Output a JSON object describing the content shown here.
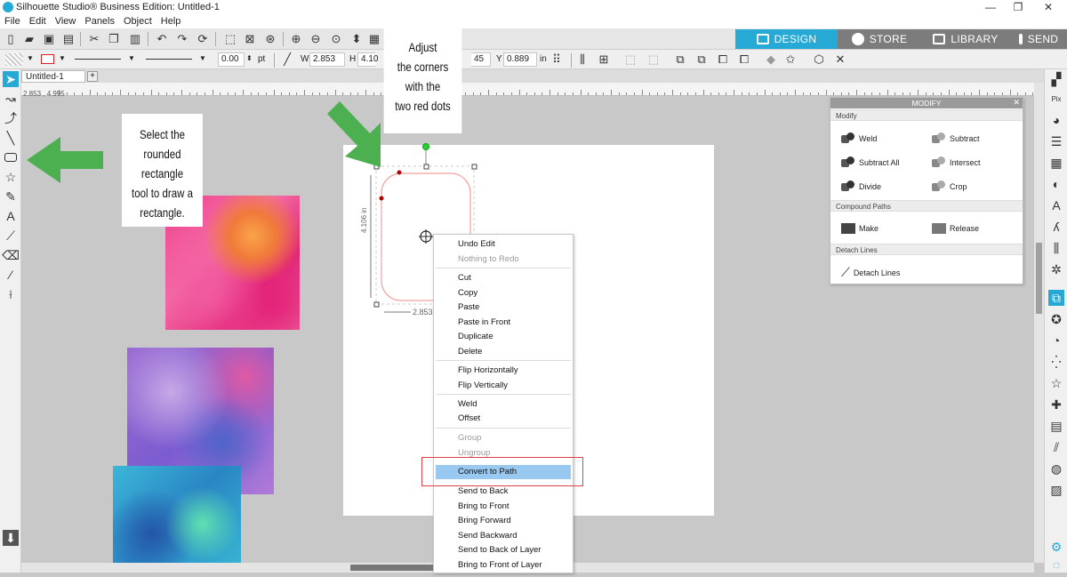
{
  "window": {
    "title": "Silhouette Studio® Business Edition: Untitled-1"
  },
  "menu": [
    "File",
    "Edit",
    "View",
    "Panels",
    "Object",
    "Help"
  ],
  "mode_tabs": [
    {
      "label": "DESIGN",
      "active": true
    },
    {
      "label": "STORE",
      "active": false
    },
    {
      "label": "LIBRARY",
      "active": false
    },
    {
      "label": "SEND",
      "active": false
    }
  ],
  "toolbar2": {
    "line_width": "0.00",
    "line_unit": "pt",
    "w_label": "W",
    "w_value": "2.853",
    "h_label": "H",
    "h_value": "4.10",
    "x_value": "45",
    "y_label": "Y",
    "y_value": "0.889",
    "y_unit": "in"
  },
  "tab": {
    "name": "Untitled-1",
    "add": "+"
  },
  "ruler": {
    "coords": "2.853 , 4.995"
  },
  "dimensions": {
    "height": "4.106 in",
    "width": "2.853"
  },
  "callouts": {
    "left": [
      "Select the",
      "rounded rectangle",
      "tool to draw a",
      "rectangle."
    ],
    "top": [
      "Adjust",
      "the corners",
      "with the",
      "two red dots"
    ]
  },
  "context_menu": {
    "items": [
      {
        "label": "Undo Edit",
        "disabled": false
      },
      {
        "label": "Nothing to Redo",
        "disabled": true
      },
      {
        "label": "Cut",
        "disabled": false
      },
      {
        "label": "Copy",
        "disabled": false
      },
      {
        "label": "Paste",
        "disabled": false
      },
      {
        "label": "Paste in Front",
        "disabled": false
      },
      {
        "label": "Duplicate",
        "disabled": false
      },
      {
        "label": "Delete",
        "disabled": false
      },
      {
        "label": "Flip Horizontally",
        "disabled": false
      },
      {
        "label": "Flip Vertically",
        "disabled": false
      },
      {
        "label": "Weld",
        "disabled": false
      },
      {
        "label": "Offset",
        "disabled": false
      },
      {
        "label": "Group",
        "disabled": true
      },
      {
        "label": "Ungroup",
        "disabled": true
      },
      {
        "label": "Convert to Path",
        "disabled": false,
        "highlighted": true
      },
      {
        "label": "Send to Back",
        "disabled": false
      },
      {
        "label": "Bring to Front",
        "disabled": false
      },
      {
        "label": "Bring Forward",
        "disabled": false
      },
      {
        "label": "Send Backward",
        "disabled": false
      },
      {
        "label": "Send to Back of Layer",
        "disabled": false
      },
      {
        "label": "Bring to Front of Layer",
        "disabled": false
      }
    ]
  },
  "modify_panel": {
    "title": "MODIFY",
    "close": "✕",
    "sections": {
      "modify": "Modify",
      "compound": "Compound Paths",
      "detach": "Detach Lines"
    },
    "buttons": {
      "weld": "Weld",
      "subtract": "Subtract",
      "subtract_all": "Subtract All",
      "intersect": "Intersect",
      "divide": "Divide",
      "crop": "Crop",
      "make": "Make",
      "release": "Release",
      "detach": "Detach Lines"
    }
  },
  "colors": {
    "accent": "#27a9d6",
    "highlight": "#99c9f1",
    "callout_arrow": "#4caf50"
  }
}
